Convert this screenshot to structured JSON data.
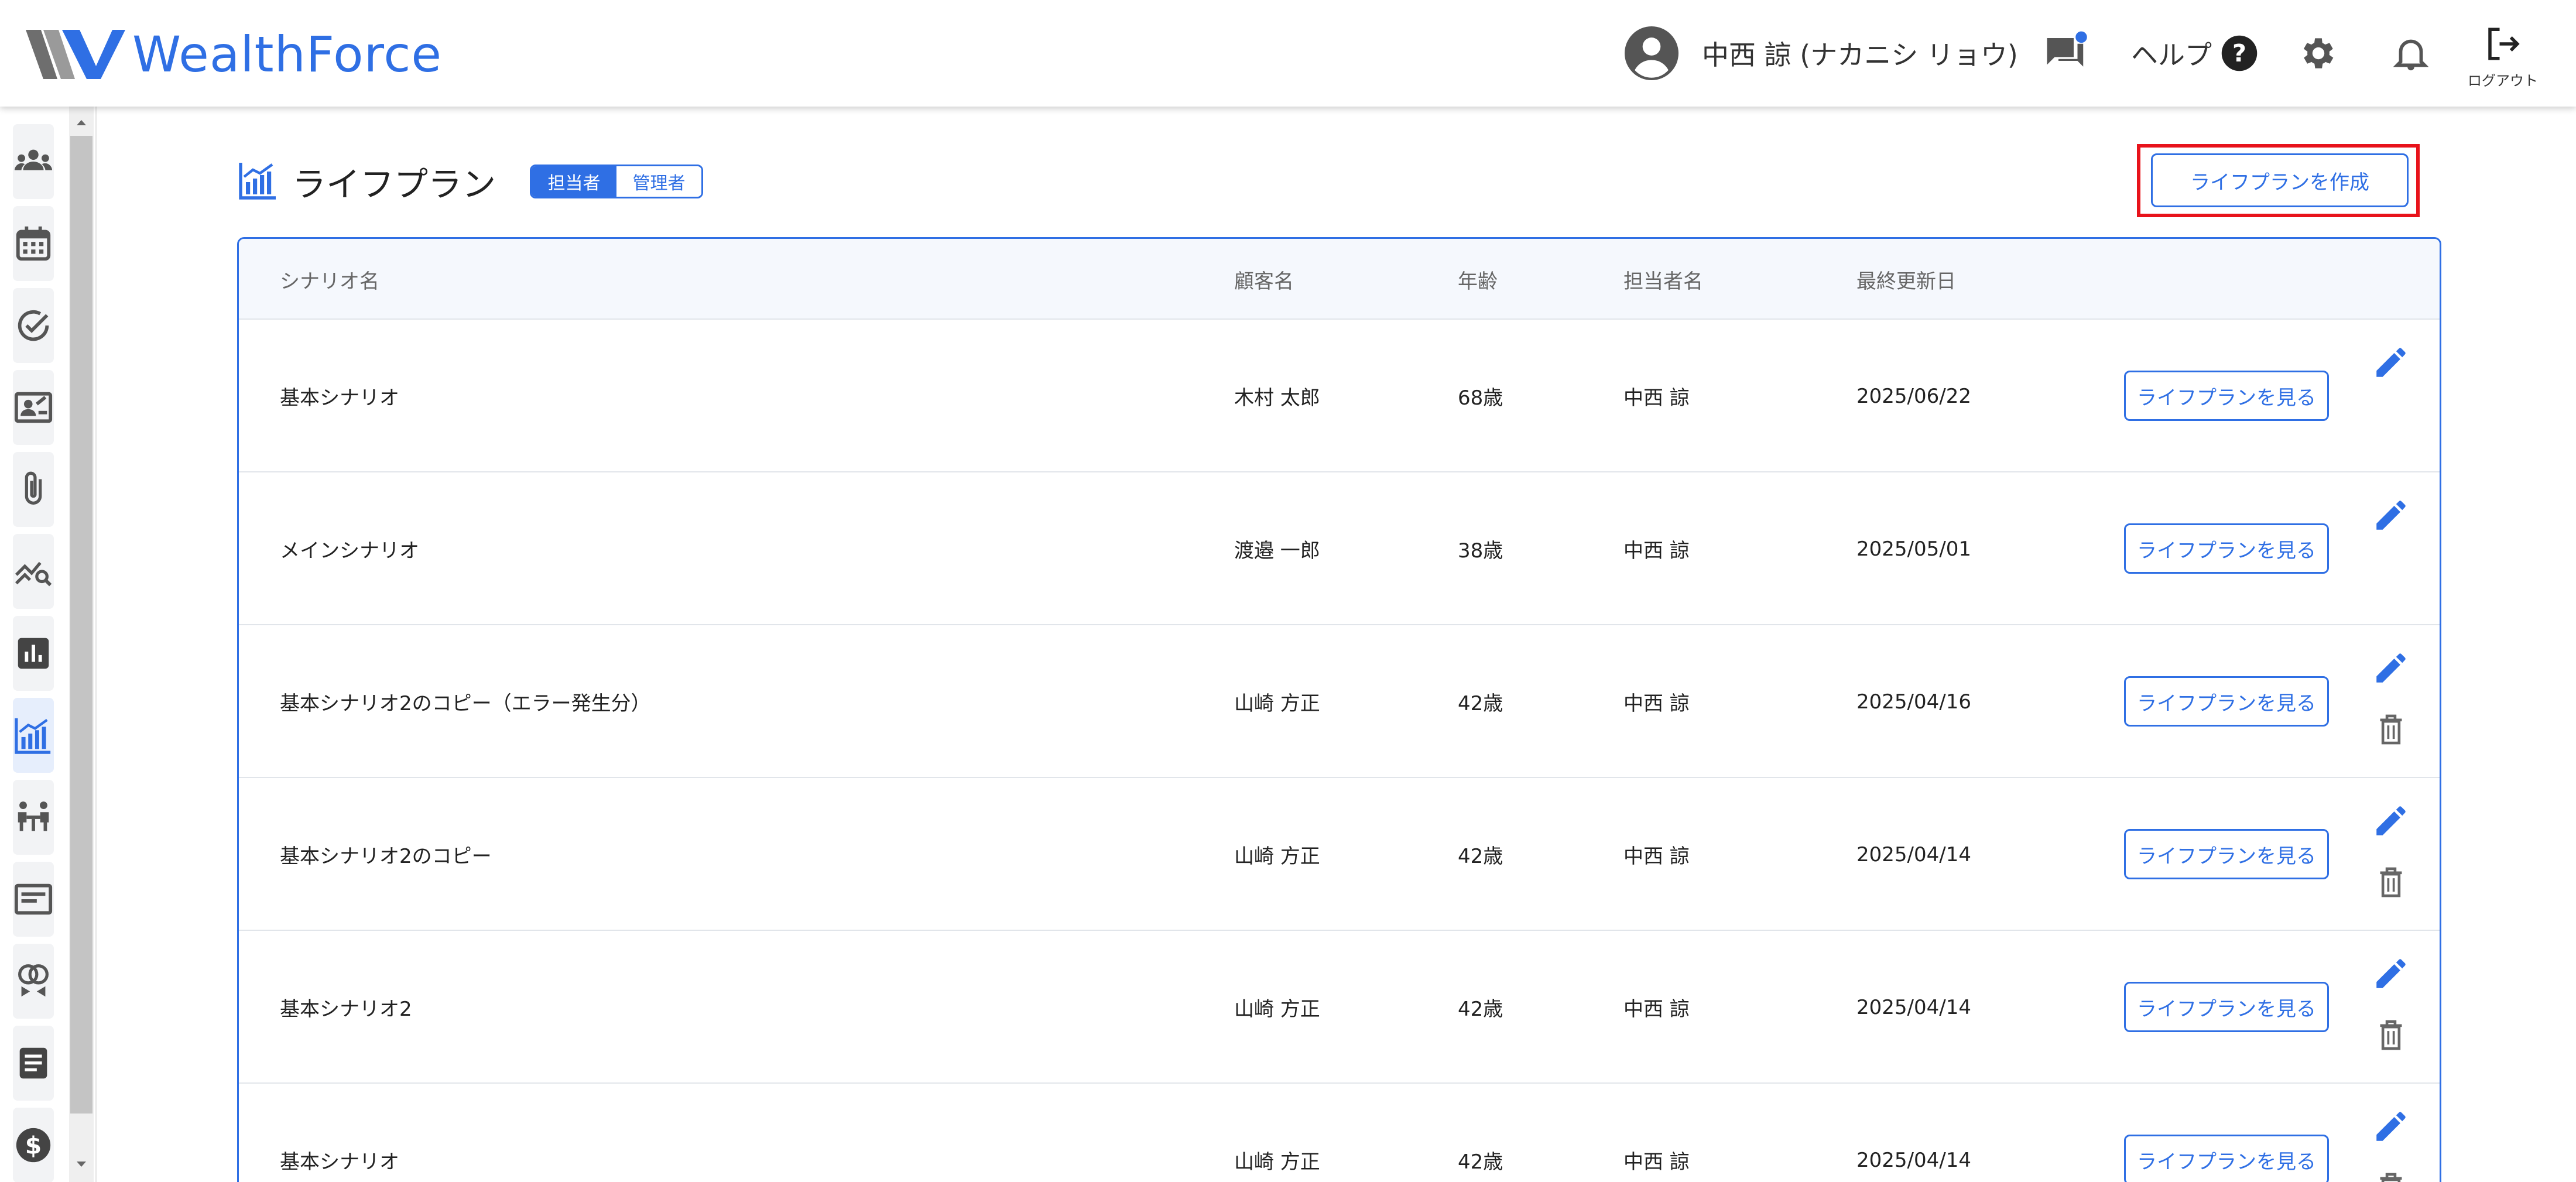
{
  "header": {
    "logo_text": "WealthForce",
    "user_name": "中西 諒 (ナカニシ リョウ)",
    "help_label": "ヘルプ",
    "logout_label": "ログアウト"
  },
  "sidebar": {
    "items": [
      {
        "icon": "groups-icon"
      },
      {
        "icon": "calendar-icon"
      },
      {
        "icon": "check-circle-icon"
      },
      {
        "icon": "contact-card-icon"
      },
      {
        "icon": "paperclip-icon"
      },
      {
        "icon": "chart-search-icon"
      },
      {
        "icon": "bar-chart-icon"
      },
      {
        "icon": "lifeplan-chart-icon",
        "active": true
      },
      {
        "icon": "meeting-icon"
      },
      {
        "icon": "newsletter-icon"
      },
      {
        "icon": "rings-icon"
      },
      {
        "icon": "document-icon"
      },
      {
        "icon": "dollar-icon"
      }
    ]
  },
  "page": {
    "title": "ライフプラン",
    "toggle": {
      "left": "担当者",
      "right": "管理者",
      "selected": "担当者"
    },
    "create_button": "ライフプランを作成"
  },
  "table": {
    "columns": [
      "シナリオ名",
      "顧客名",
      "年齢",
      "担当者名",
      "最終更新日"
    ],
    "view_button_label": "ライフプランを見る",
    "rows": [
      {
        "scenario": "基本シナリオ",
        "customer": "木村 太郎",
        "age": "68歳",
        "staff": "中西 諒",
        "updated": "2025/06/22",
        "deletable": false
      },
      {
        "scenario": "メインシナリオ",
        "customer": "渡邉 一郎",
        "age": "38歳",
        "staff": "中西 諒",
        "updated": "2025/05/01",
        "deletable": false
      },
      {
        "scenario": "基本シナリオ2のコピー（エラー発生分）",
        "customer": "山崎 方正",
        "age": "42歳",
        "staff": "中西 諒",
        "updated": "2025/04/16",
        "deletable": true
      },
      {
        "scenario": "基本シナリオ2のコピー",
        "customer": "山崎 方正",
        "age": "42歳",
        "staff": "中西 諒",
        "updated": "2025/04/14",
        "deletable": true
      },
      {
        "scenario": "基本シナリオ2",
        "customer": "山崎 方正",
        "age": "42歳",
        "staff": "中西 諒",
        "updated": "2025/04/14",
        "deletable": true
      },
      {
        "scenario": "基本シナリオ",
        "customer": "山崎 方正",
        "age": "42歳",
        "staff": "中西 諒",
        "updated": "2025/04/14",
        "deletable": true
      }
    ]
  },
  "colors": {
    "accent": "#2f6fe4",
    "highlight": "#e8131b",
    "icon_gray": "#555555"
  }
}
